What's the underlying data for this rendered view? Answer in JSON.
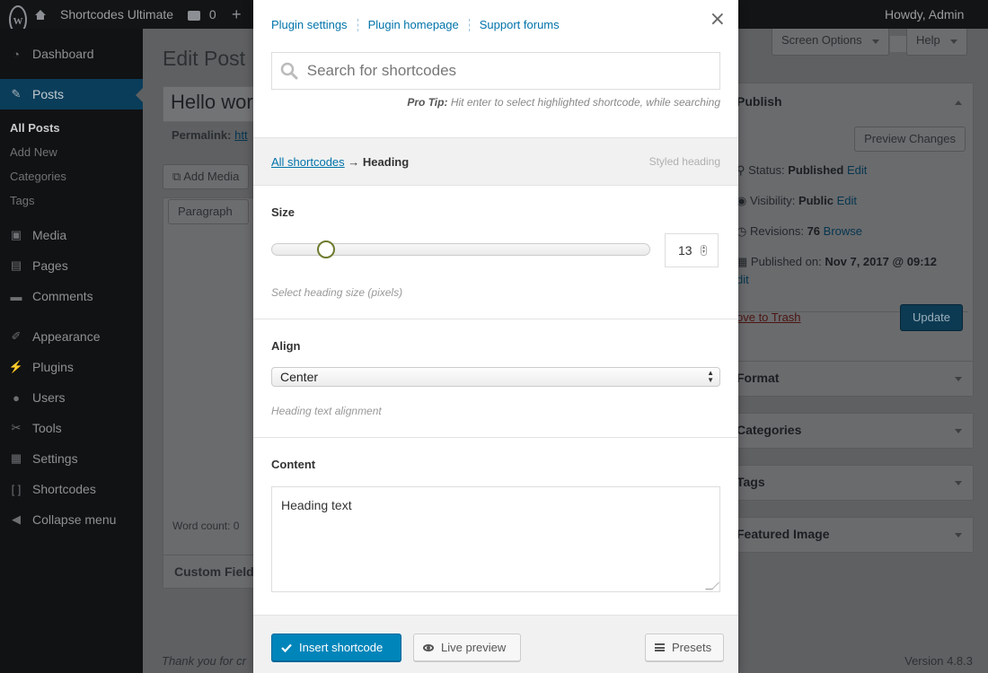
{
  "adminbar": {
    "site_name": "Shortcodes Ultimate",
    "comments_count": "0",
    "greeting": "Howdy, Admin"
  },
  "sidebar": {
    "items": [
      {
        "label": "Dashboard",
        "icon": "dashboard-icon"
      },
      {
        "label": "Posts",
        "icon": "pushpin-icon"
      },
      {
        "label": "Media",
        "icon": "media-icon"
      },
      {
        "label": "Pages",
        "icon": "pages-icon"
      },
      {
        "label": "Comments",
        "icon": "comment-icon"
      },
      {
        "label": "Appearance",
        "icon": "paintbrush-icon"
      },
      {
        "label": "Plugins",
        "icon": "plugin-icon"
      },
      {
        "label": "Users",
        "icon": "users-icon"
      },
      {
        "label": "Tools",
        "icon": "wrench-icon"
      },
      {
        "label": "Settings",
        "icon": "settings-icon"
      },
      {
        "label": "Shortcodes",
        "icon": "brackets-icon"
      },
      {
        "label": "Collapse menu",
        "icon": "collapse-icon"
      }
    ],
    "submenu": [
      "All Posts",
      "Add New",
      "Categories",
      "Tags"
    ]
  },
  "page": {
    "title": "Edit Post",
    "screen_options": "Screen Options",
    "help": "Help",
    "post_title": "Hello wor",
    "permalink_label": "Permalink:",
    "permalink_url": "htt",
    "add_media": "Add Media",
    "format_select": "Paragraph",
    "word_count": "Word count: 0",
    "custom_fields": "Custom Field",
    "thanks": "Thank you for cr",
    "version": "Version 4.8.3"
  },
  "publish_box": {
    "title": "Publish",
    "preview_button": "Preview Changes",
    "status_label": "Status:",
    "status_value": "Published",
    "visibility_label": "Visibility:",
    "visibility_value": "Public",
    "revisions_label": "Revisions:",
    "revisions_value": "76",
    "browse_link": "Browse",
    "published_label": "Published on:",
    "published_value": "Nov 7, 2017 @ 09:12",
    "edit_link": "Edit",
    "edit_partial": "dit",
    "trash_link": "ove to Trash",
    "update_button": "Update"
  },
  "side_boxes": [
    "Format",
    "Categories",
    "Tags",
    "Featured Image"
  ],
  "modal": {
    "links": [
      "Plugin settings",
      "Plugin homepage",
      "Support forums"
    ],
    "search_placeholder": "Search for shortcodes",
    "protip_label": "Pro Tip:",
    "protip_text": "Hit enter to select highlighted shortcode, while searching",
    "breadcrumb_root": "All shortcodes",
    "breadcrumb_arrow": "→",
    "breadcrumb_current": "Heading",
    "breadcrumb_desc": "Styled heading",
    "size_label": "Size",
    "size_value": "13",
    "size_slider_fraction": 0.145,
    "size_desc": "Select heading size (pixels)",
    "align_label": "Align",
    "align_value": "Center",
    "align_desc": "Heading text alignment",
    "content_label": "Content",
    "content_value": "Heading text",
    "insert_button": "Insert shortcode",
    "preview_button": "Live preview",
    "presets_button": "Presets"
  },
  "colors": {
    "accent": "#0073aa",
    "primary_button": "#0085ba",
    "slider_handle_border": "#6f7a2e"
  }
}
